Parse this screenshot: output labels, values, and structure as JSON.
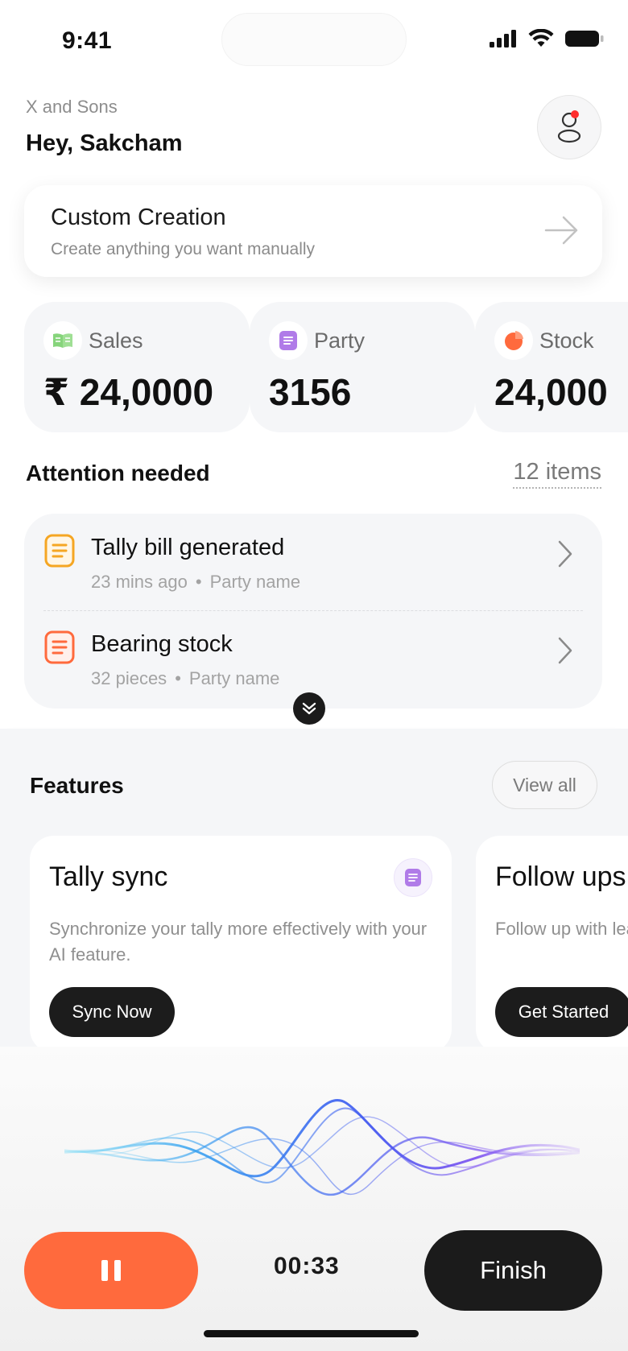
{
  "status_bar": {
    "time": "9:41"
  },
  "header": {
    "company": "X and Sons",
    "greeting": "Hey, Sakcham"
  },
  "custom_creation": {
    "title": "Custom Creation",
    "subtitle": "Create anything you want manually"
  },
  "stats": [
    {
      "label": "Sales",
      "value": "₹ 24,0000",
      "icon": "book-icon",
      "color": "#86d47b"
    },
    {
      "label": "Party",
      "value": "3156",
      "icon": "document-icon",
      "color": "#b07be8"
    },
    {
      "label": "Stock",
      "value": "24,000",
      "icon": "pie-chart-icon",
      "color": "#ff6a3d"
    }
  ],
  "attention": {
    "title": "Attention needed",
    "count": "12 items",
    "items": [
      {
        "title": "Tally bill generated",
        "meta": "23 mins ago",
        "party": "Party name",
        "icon": "document-icon",
        "color": "#f5a623"
      },
      {
        "title": "Bearing stock",
        "meta": "32 pieces",
        "party": "Party name",
        "icon": "document-icon",
        "color": "#ff6a3d"
      }
    ],
    "separator": "•"
  },
  "features": {
    "title": "Features",
    "view_all": "View all",
    "cards": [
      {
        "title": "Tally sync",
        "description": "Synchronize your tally more effectively with your AI feature.",
        "button": "Sync Now",
        "icon": "document-icon"
      },
      {
        "title": "Follow ups",
        "description": "Follow up with leads",
        "button": "Get Started"
      }
    ]
  },
  "voice": {
    "timer": "00:33",
    "finish": "Finish"
  },
  "colors": {
    "accent": "#ff6a3d",
    "dark": "#1b1b1b"
  }
}
